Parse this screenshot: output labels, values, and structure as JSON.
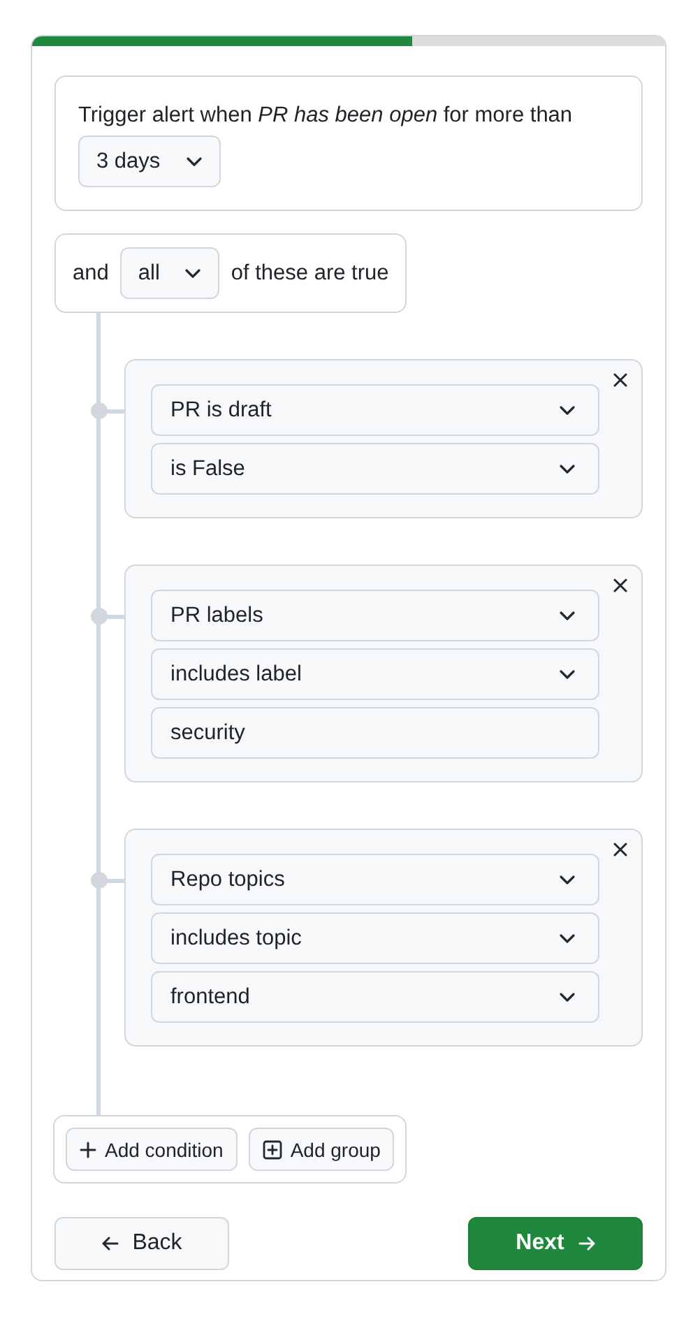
{
  "progress": {
    "level": 0.6
  },
  "trigger": {
    "sentence": "Trigger alert when *PR has been open* for more than",
    "duration": "3 days"
  },
  "group": {
    "prefix": "and",
    "quantifier": "all",
    "suffix": "of these are true"
  },
  "conditions": [
    {
      "fields": [
        {
          "kind": "select",
          "value": "PR is draft"
        },
        {
          "kind": "select",
          "value": "is False"
        }
      ]
    },
    {
      "fields": [
        {
          "kind": "select",
          "value": "PR labels"
        },
        {
          "kind": "select",
          "value": "includes label"
        },
        {
          "kind": "text",
          "value": "security"
        }
      ]
    },
    {
      "fields": [
        {
          "kind": "select",
          "value": "Repo topics"
        },
        {
          "kind": "select",
          "value": "includes topic"
        },
        {
          "kind": "select",
          "value": "frontend"
        }
      ]
    }
  ],
  "add_buttons": [
    {
      "kind": "condition",
      "label": "Add condition"
    },
    {
      "kind": "group",
      "label": "Add group"
    }
  ],
  "footer": {
    "back": "Back",
    "next": "Next"
  }
}
